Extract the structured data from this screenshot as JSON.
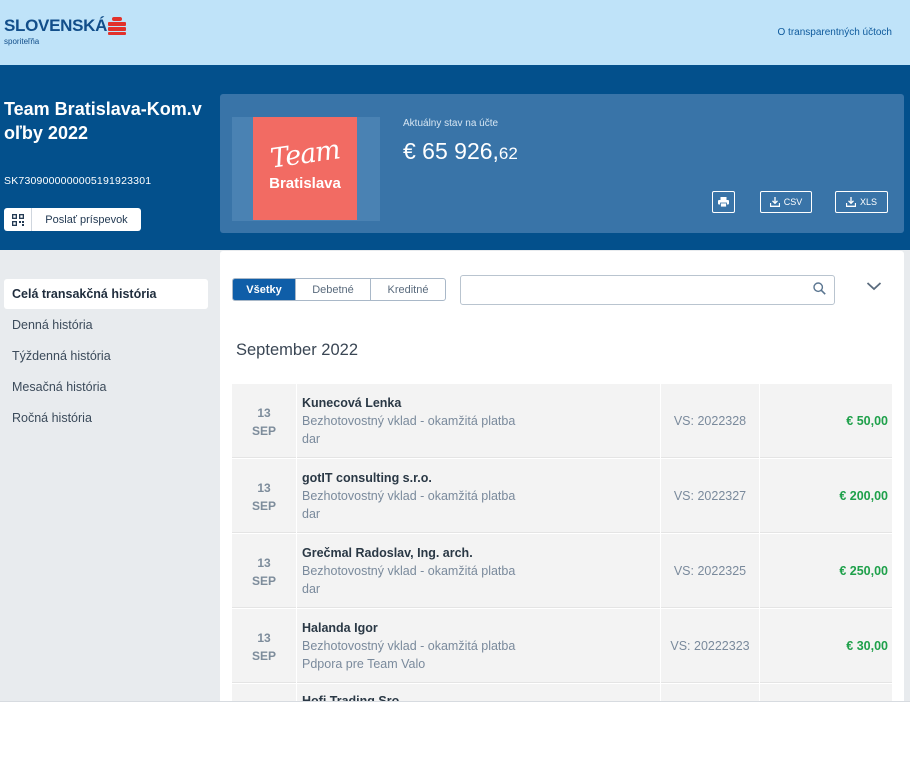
{
  "header": {
    "brand_name": "SLOVENSKÁ",
    "brand_sub": "sporiteľňa",
    "link": "O transparentných účtoch"
  },
  "account": {
    "title": "Team Bratislava-Kom.voľby 2022",
    "iban": "SK7309000000005191923301",
    "send_button": "Poslať príspevok"
  },
  "balance": {
    "label": "Aktuálny stav na účte",
    "main": "€ 65 926,",
    "cents": "62",
    "logo_script": "Team",
    "logo_city": "Bratislava",
    "actions": {
      "print": "",
      "csv": "CSV",
      "xls": "XLS"
    }
  },
  "sidebar": {
    "items": [
      {
        "label": "Celá transakčná história",
        "active": true
      },
      {
        "label": "Denná história"
      },
      {
        "label": "Týždenná história"
      },
      {
        "label": "Mesačná história"
      },
      {
        "label": "Ročná história"
      }
    ]
  },
  "filters": {
    "tabs": [
      "Všetky",
      "Debetné",
      "Kreditné"
    ],
    "search_placeholder": ""
  },
  "month": "September 2022",
  "transactions": [
    {
      "day": "13",
      "mon": "SEP",
      "name": "Kunecová Lenka",
      "type": "Bezhotovostný vklad - okamžitá platba",
      "note": "dar",
      "vs": "VS: 2022328",
      "amount": "€ 50,00"
    },
    {
      "day": "13",
      "mon": "SEP",
      "name": "gotIT consulting s.r.o.",
      "type": "Bezhotovostný vklad - okamžitá platba",
      "note": "dar",
      "vs": "VS: 2022327",
      "amount": "€ 200,00"
    },
    {
      "day": "13",
      "mon": "SEP",
      "name": "Grečmal Radoslav, Ing. arch.",
      "type": "Bezhotovostný vklad - okamžitá platba",
      "note": "dar",
      "vs": "VS: 2022325",
      "amount": "€ 250,00"
    },
    {
      "day": "13",
      "mon": "SEP",
      "name": "Halanda Igor",
      "type": "Bezhotovostný vklad - okamžitá platba",
      "note": "Pdpora pre Team Valo",
      "vs": "VS: 20222323",
      "amount": "€ 30,00"
    },
    {
      "name": "Hofi Trading Sro"
    }
  ],
  "colors": {
    "band": "#03508c",
    "card": "#3974a8",
    "accent": "#0f5ea8",
    "amount_green": "#1ea04a",
    "team_logo": "#f26b63"
  }
}
